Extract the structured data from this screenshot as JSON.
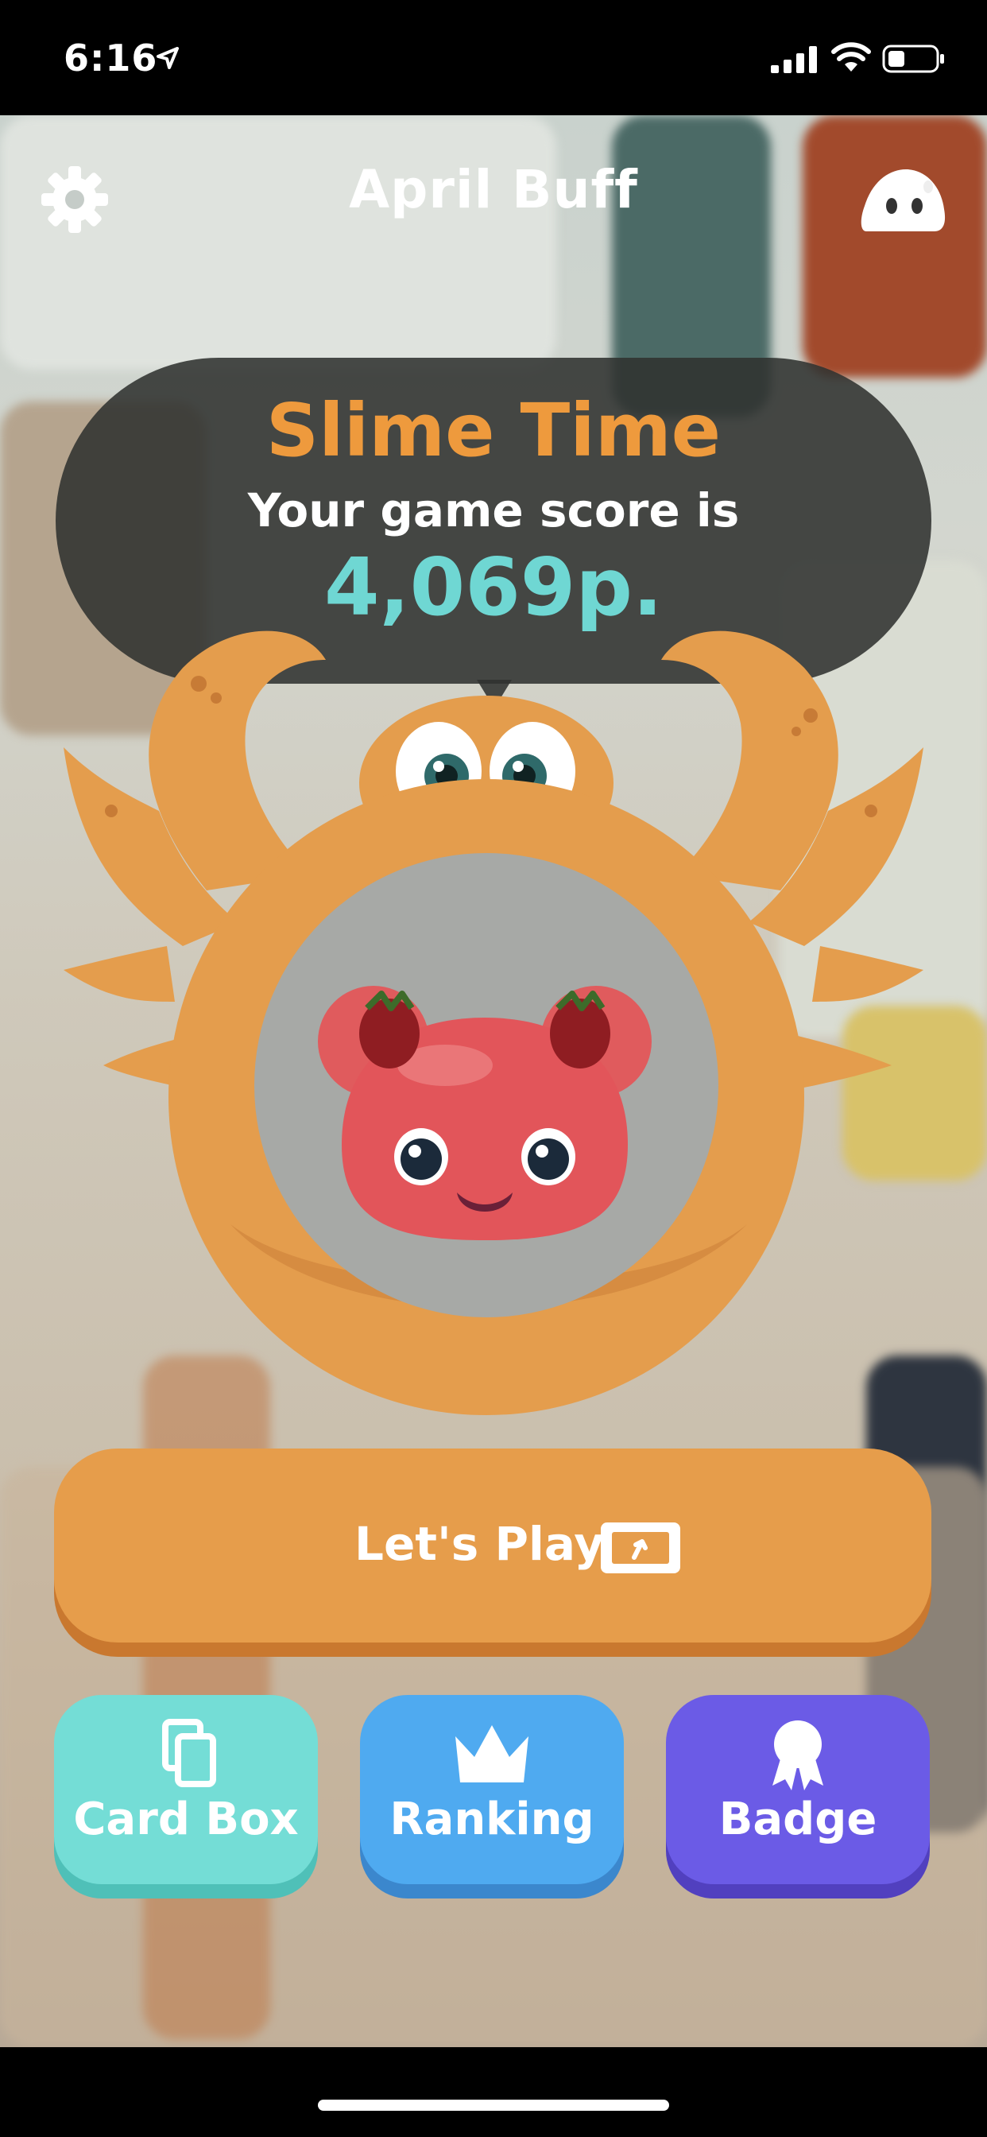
{
  "status_bar": {
    "time": "6:16"
  },
  "header": {
    "title": "April Buff"
  },
  "result": {
    "game_title": "Slime Time",
    "score_label": "Your game score is",
    "score_value": "4,069p."
  },
  "actions": {
    "play_label": "Let's Play",
    "tiles": [
      {
        "label": "Card Box",
        "color": "#74ddd6"
      },
      {
        "label": "Ranking",
        "color": "#4faaf0"
      },
      {
        "label": "Badge",
        "color": "#6b5be6"
      }
    ]
  },
  "colors": {
    "accent_orange": "#e69d4b",
    "title_orange": "#ee9a3d",
    "score_cyan": "#6fd7d3",
    "bubble": "#303230"
  }
}
